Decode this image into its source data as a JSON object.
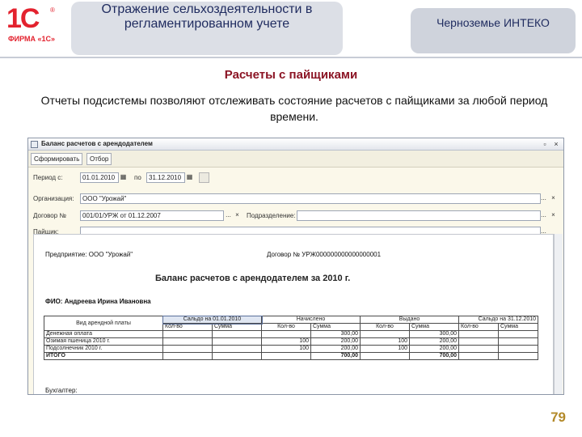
{
  "header": {
    "logo_main": "1С",
    "logo_reg": "®",
    "logo_sub": "ФИРМА «1С»",
    "title": "Отражение сельхоздеятельности в регламентированном учете",
    "company": "Черноземье ИНТЕКО"
  },
  "slide": {
    "section": "Расчеты с пайщиками",
    "description": "Отчеты подсистемы позволяют отслеживать состояние расчетов с пайщиками за любой период времени.",
    "page_number": "79"
  },
  "window": {
    "title": "Баланс расчетов с арендодателем",
    "controls": [
      "▫",
      "×"
    ],
    "toolbar": {
      "form_button": "Сформировать",
      "filter_button": "Отбор"
    },
    "form": {
      "period_label": "Период с:",
      "period_from": "01.01.2010",
      "period_to_label": "по",
      "period_to": "31.12.2010",
      "org_label": "Организация:",
      "org_value": "ООО \"Урожай\"",
      "contract_label": "Договор №",
      "contract_value": "001/01/УРЖ от 01.12.2007",
      "division_label": "Подразделение:",
      "division_value": "",
      "shareholder_label": "Пайщик:",
      "shareholder_value": "",
      "select_btn": "...",
      "clear_btn": "×"
    }
  },
  "report": {
    "enterprise": "Предприятие: ООО \"Урожай\"",
    "contract": "Договор № УРЖ000000000000000001",
    "title": "Баланс расчетов с арендодателем за 2010 г.",
    "fio": "ФИО: Андреева Ирина Ивановна",
    "headers": {
      "rent_type": "Вид арендной платы",
      "balance_start": "Сальдо на 01.01.2010",
      "accrued": "Начислено",
      "issued": "Выдано",
      "balance_end": "Сальдо на 31.12.2010",
      "qty": "Кол-во",
      "sum": "Сумма"
    },
    "rows": [
      {
        "name": "Денежная оплата",
        "cells": [
          "",
          "",
          "",
          "300,00",
          "",
          "300,00",
          "",
          ""
        ]
      },
      {
        "name": "Озимая пшеница 2010 г.",
        "cells": [
          "",
          "",
          "100",
          "200,00",
          "100",
          "200,00",
          "",
          ""
        ]
      },
      {
        "name": "Подсолнечник 2010 г.",
        "cells": [
          "",
          "",
          "100",
          "200,00",
          "100",
          "200,00",
          "",
          ""
        ]
      },
      {
        "name": "ИТОГО",
        "cells": [
          "",
          "",
          "",
          "700,00",
          "",
          "700,00",
          "",
          ""
        ]
      }
    ],
    "footer": "Бухгалтер:"
  }
}
